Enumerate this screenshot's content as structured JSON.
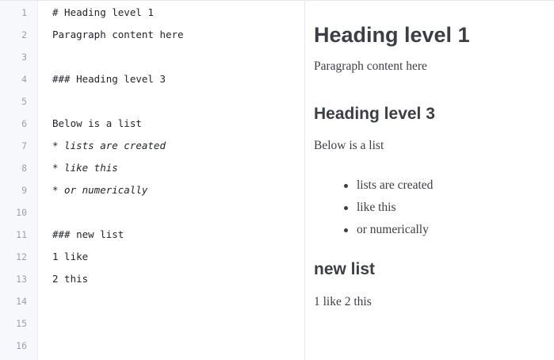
{
  "editor": {
    "line_numbers": [
      "1",
      "2",
      "3",
      "4",
      "5",
      "6",
      "7",
      "8",
      "9",
      "10",
      "11",
      "12",
      "13",
      "14",
      "15",
      "16"
    ],
    "lines": [
      "# Heading level 1",
      "Paragraph content here",
      "",
      "### Heading level 3",
      "",
      "Below is a list",
      "* lists are created",
      "* like this",
      "* or numerically",
      "",
      "### new list",
      "1 like",
      "2 this",
      "",
      "",
      ""
    ]
  },
  "preview": {
    "h1": "Heading level 1",
    "p1": "Paragraph content here",
    "h3a": "Heading level 3",
    "p2": "Below is a list",
    "list_items": [
      "lists are created",
      "like this",
      "or numerically"
    ],
    "h3b": "new list",
    "p3": "1 like 2 this"
  }
}
